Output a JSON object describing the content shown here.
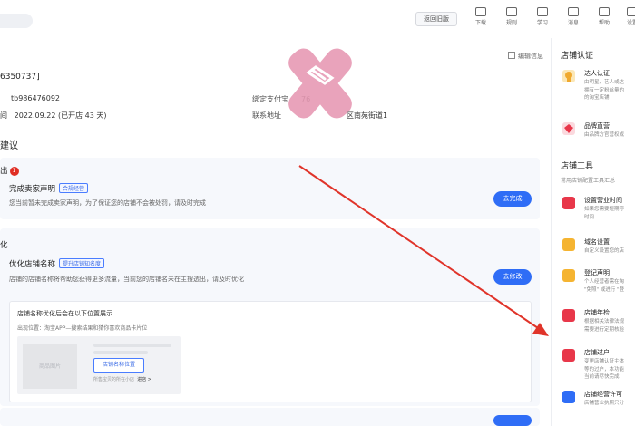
{
  "topbar": {
    "back_label": "返回旧版",
    "nav": [
      "下载",
      "规则",
      "学习",
      "消息",
      "帮助",
      "设置"
    ]
  },
  "info": {
    "edit_label": "编辑信息",
    "shop_id": "6350737]",
    "account": "tb986476092",
    "date": "2022.09.22 (已开店 43 天)",
    "date_prefix": "间",
    "pay_label": "绑定支付宝",
    "pay_value_partial": "76",
    "address_label": "联系地址",
    "address_value": "区南苑街道1"
  },
  "suggest": {
    "title": "建议",
    "group1": {
      "title": "出",
      "badge": "1"
    },
    "task1": {
      "title": "完成卖家声明",
      "tag": "合规经营",
      "desc": "您当前暂未完成卖家声明，为了保证您的店铺不会被处罚，请及时完成",
      "button": "去完成"
    },
    "group2": {
      "title": "化"
    },
    "task2": {
      "title": "优化店铺名称",
      "tag": "提升店铺知名度",
      "desc": "店铺的店铺名称将帮助您获得更多流量，当前您的店铺名未在主搜透出，请及时优化",
      "button": "去修改"
    },
    "preview": {
      "title": "店铺名称优化后会在以下位置展示",
      "location": "出现位置：淘宝APP—搜索结果和猜你喜欢商品卡片位",
      "thumb_label": "商品图片",
      "name_box": "店铺名称位置",
      "foot": "所售宝贝的所在小店",
      "foot_link": "进店 >"
    }
  },
  "right": {
    "cert_title": "店铺认证",
    "cert_items": [
      {
        "title": "达人认证",
        "desc": [
          "由明星、艺人或达",
          "拥有一定粉丝量的",
          "的淘宝店铺"
        ],
        "color": "#f0a92e"
      },
      {
        "title": "品牌直营",
        "desc": [
          "由品牌方官营权或"
        ],
        "color": "#e8374a"
      }
    ],
    "tools_title": "店铺工具",
    "tools_sub": "常用店铺配置工具汇总",
    "tools": [
      {
        "title": "设置营业时间",
        "desc": [
          "如果您需要短期停",
          "时间"
        ],
        "color": "#e8374a"
      },
      {
        "title": "域名设置",
        "desc": [
          "自定义设置您的店"
        ],
        "color": "#f0a92e"
      },
      {
        "title": "登记声明",
        "desc": [
          "个人经营者需在淘",
          "\"免照\" 或进行 \"登"
        ],
        "color": "#f0a92e"
      },
      {
        "title": "店铺年检",
        "desc": [
          "根据相关法律法规",
          "需要进行定期核验"
        ],
        "color": "#e8374a"
      },
      {
        "title": "店铺过户",
        "desc": [
          "变更店铺认证主体",
          "等的过户，本功能",
          "当前请尽快完成"
        ],
        "color": "#e8374a"
      },
      {
        "title": "店铺经营许可",
        "desc": [
          "店铺营业执照只分"
        ],
        "color": "#2f6df6"
      }
    ]
  },
  "colors": {
    "primary": "#2f6df6",
    "badge": "#e02e24",
    "arrow": "#e0342a",
    "watermark": "#e79ab4"
  }
}
